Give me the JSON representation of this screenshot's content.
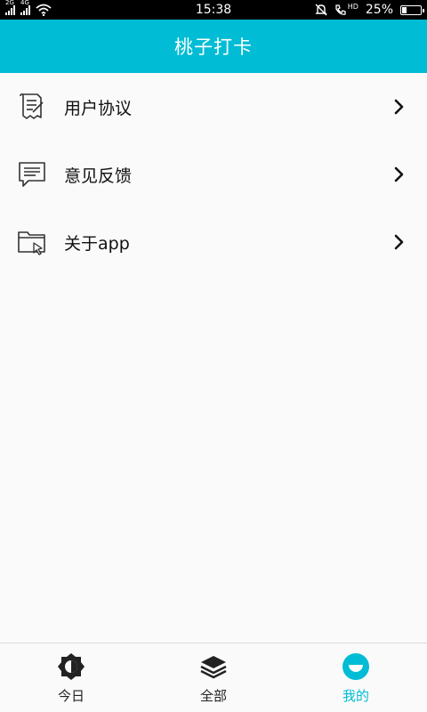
{
  "status_bar": {
    "sim1_tag": "2G",
    "sim2_tag": "4G",
    "time": "15:38",
    "hd_tag": "HD",
    "battery": "25%",
    "battery_level": 0.25
  },
  "header": {
    "title": "桃子打卡"
  },
  "menu": {
    "items": [
      {
        "label": "用户协议",
        "icon": "document-icon"
      },
      {
        "label": "意见反馈",
        "icon": "chat-bubble-icon"
      },
      {
        "label": "关于app",
        "icon": "folder-icon"
      }
    ]
  },
  "tabbar": {
    "tabs": [
      {
        "label": "今日",
        "icon": "sun-half-icon",
        "active": false
      },
      {
        "label": "全部",
        "icon": "layers-icon",
        "active": false
      },
      {
        "label": "我的",
        "icon": "smile-icon",
        "active": true
      }
    ]
  },
  "colors": {
    "accent": "#00bcd4",
    "background": "#fafafa",
    "text": "#111111"
  }
}
